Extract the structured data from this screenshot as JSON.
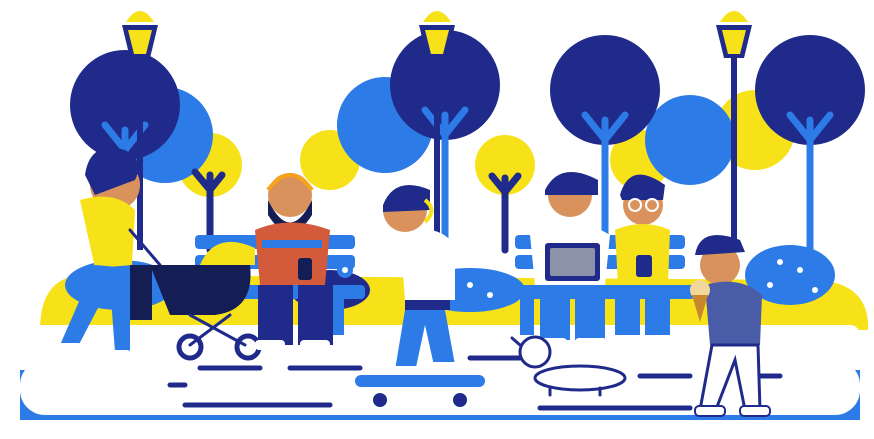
{
  "scene": {
    "subject": "park-scene-illustration",
    "palette": {
      "navy": "#1f2a8a",
      "blue": "#2d7be6",
      "yellow": "#f7e21a",
      "skin": "#d9925b",
      "dark": "#151d55",
      "white": "#ffffff",
      "lamp_glow": "#fff6a8"
    },
    "figures": [
      {
        "name": "woman-with-stroller"
      },
      {
        "name": "bearded-man-with-headphones-and-phone"
      },
      {
        "name": "boy-skateboarding-with-headphones"
      },
      {
        "name": "man-with-laptop"
      },
      {
        "name": "man-with-glasses-and-phone"
      },
      {
        "name": "man-with-ice-cream"
      },
      {
        "name": "dog"
      }
    ],
    "objects": [
      {
        "name": "street-lamp"
      },
      {
        "name": "street-lamp"
      },
      {
        "name": "street-lamp"
      },
      {
        "name": "park-bench-left"
      },
      {
        "name": "park-bench-right"
      },
      {
        "name": "stroller"
      },
      {
        "name": "skateboard"
      },
      {
        "name": "laptop"
      }
    ]
  }
}
